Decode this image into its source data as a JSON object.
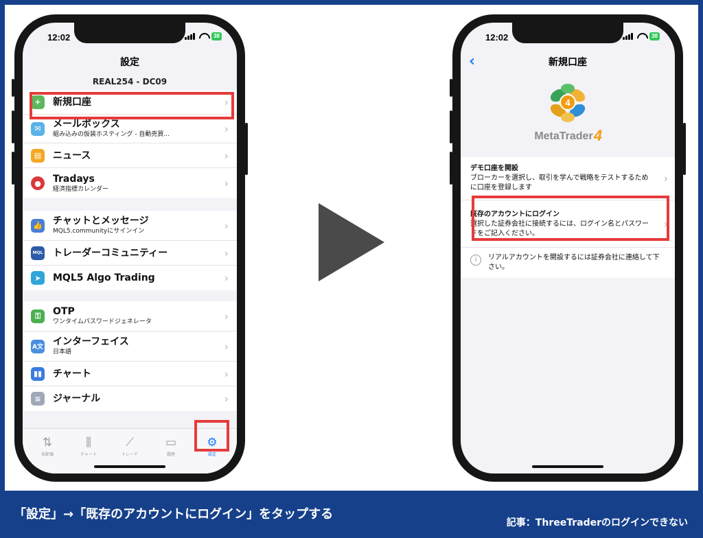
{
  "colors": {
    "accent": "#1a7cf5",
    "highlight": "#e63b3b",
    "footer_bg": "#16408a",
    "arrow": "#4a4a4a"
  },
  "left_phone": {
    "time": "12:02",
    "battery": "38",
    "title": "設定",
    "account": "REAL254 - DC09",
    "groups": [
      [
        {
          "icon": "person-add-icon",
          "title": "新規口座",
          "sub": ""
        },
        {
          "icon": "mailbox-icon",
          "title": "メールボックス",
          "sub": "組み込みの仮装ホスティング - 自動売買..."
        },
        {
          "icon": "news-icon",
          "title": "ニュース",
          "sub": ""
        },
        {
          "icon": "tradays-icon",
          "title": "Tradays",
          "sub": "経済指標カレンダー"
        }
      ],
      [
        {
          "icon": "chat-icon",
          "title": "チャットとメッセージ",
          "sub": "MQL5.communityにサインイン"
        },
        {
          "icon": "mql5-icon",
          "title": "トレーダーコミュニティー",
          "sub": ""
        },
        {
          "icon": "telegram-icon",
          "title": "MQL5 Algo Trading",
          "sub": ""
        }
      ],
      [
        {
          "icon": "otp-icon",
          "title": "OTP",
          "sub": "ワンタイムパスワードジェネレータ"
        },
        {
          "icon": "translate-icon",
          "title": "インターフェイス",
          "sub": "日本語"
        },
        {
          "icon": "chart-icon",
          "title": "チャート",
          "sub": ""
        },
        {
          "icon": "journal-icon",
          "title": "ジャーナル",
          "sub": ""
        }
      ]
    ],
    "tabs": [
      {
        "icon": "quotes-icon",
        "label": "気配値"
      },
      {
        "icon": "candles-icon",
        "label": "チャート"
      },
      {
        "icon": "trade-icon",
        "label": "トレード"
      },
      {
        "icon": "history-icon",
        "label": "履歴"
      },
      {
        "icon": "gear-icon",
        "label": "設定"
      }
    ]
  },
  "right_phone": {
    "time": "12:02",
    "battery": "38",
    "title": "新規口座",
    "logo_text": "MetaTrader",
    "logo_num": "4",
    "logo_badge": "4",
    "options": [
      {
        "title": "デモ口座を開設",
        "desc": "ブローカーを選択し、取引を学んで戦略をテストするために口座を登録します"
      },
      {
        "title": "既存のアカウントにログイン",
        "desc": "選択した証券会社に接続するには、ログイン名とパスワードをご記入ください。"
      }
    ],
    "info": "リアルアカウントを開設するには証券会社に連絡して下さい。"
  },
  "footer": {
    "message": "「設定」→「既存のアカウントにログイン」をタップする",
    "article": "記事：ThreeTraderのログインできない"
  }
}
